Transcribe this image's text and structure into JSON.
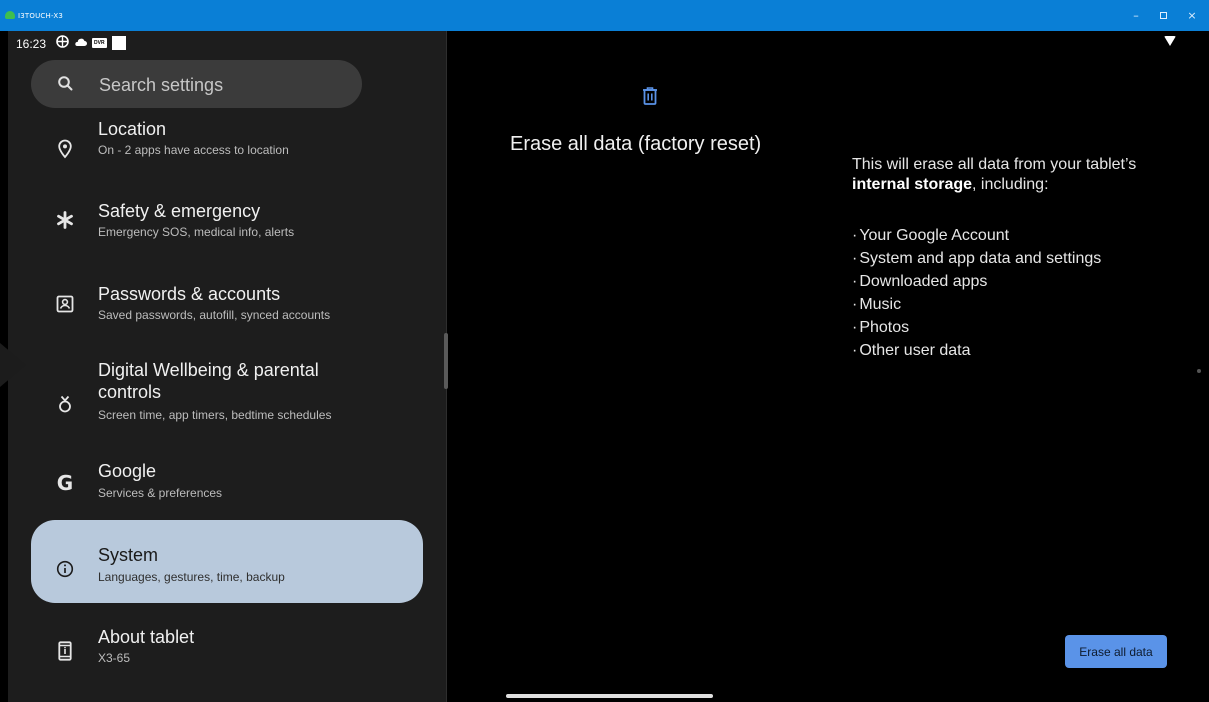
{
  "window": {
    "title": "I3TOUCH-X3",
    "minimize_glyph": "–",
    "close_glyph": "×"
  },
  "status_bar": {
    "time": "16:23",
    "dvr_badge": "DVR"
  },
  "search": {
    "placeholder": "Search settings"
  },
  "settings": {
    "items": [
      {
        "icon": "location-pin-icon",
        "title": "Location",
        "subtitle": "On - 2 apps have access to location"
      },
      {
        "icon": "asterisk-icon",
        "title": "Safety & emergency",
        "subtitle": "Emergency SOS, medical info, alerts"
      },
      {
        "icon": "account-box-icon",
        "title": "Passwords & accounts",
        "subtitle": "Saved passwords, autofill, synced accounts"
      },
      {
        "icon": "wellbeing-icon",
        "title": "Digital Wellbeing & parental controls",
        "subtitle": "Screen time, app timers, bedtime schedules"
      },
      {
        "icon": "google-icon",
        "icon_glyph": "G",
        "title": "Google",
        "subtitle": "Services & preferences"
      },
      {
        "icon": "info-icon",
        "title": "System",
        "subtitle": "Languages, gestures, time, backup",
        "selected": true
      },
      {
        "icon": "tablet-icon",
        "title": "About tablet",
        "subtitle": "X3-65"
      }
    ]
  },
  "detail": {
    "title": "Erase all data (factory reset)",
    "description_prefix": "This will erase all data from your tablet’s ",
    "description_bold": "internal storage",
    "description_suffix": ", including:",
    "bullets": [
      "Your Google Account",
      "System and app data and settings",
      "Downloaded apps",
      "Music",
      "Photos",
      "Other user data"
    ],
    "erase_button": "Erase all data"
  },
  "colors": {
    "title_bar": "#0a7fd6",
    "selected_item_bg": "#b8c9dc",
    "accent": "#5a93e8",
    "panel_bg": "#1d1d1d"
  }
}
